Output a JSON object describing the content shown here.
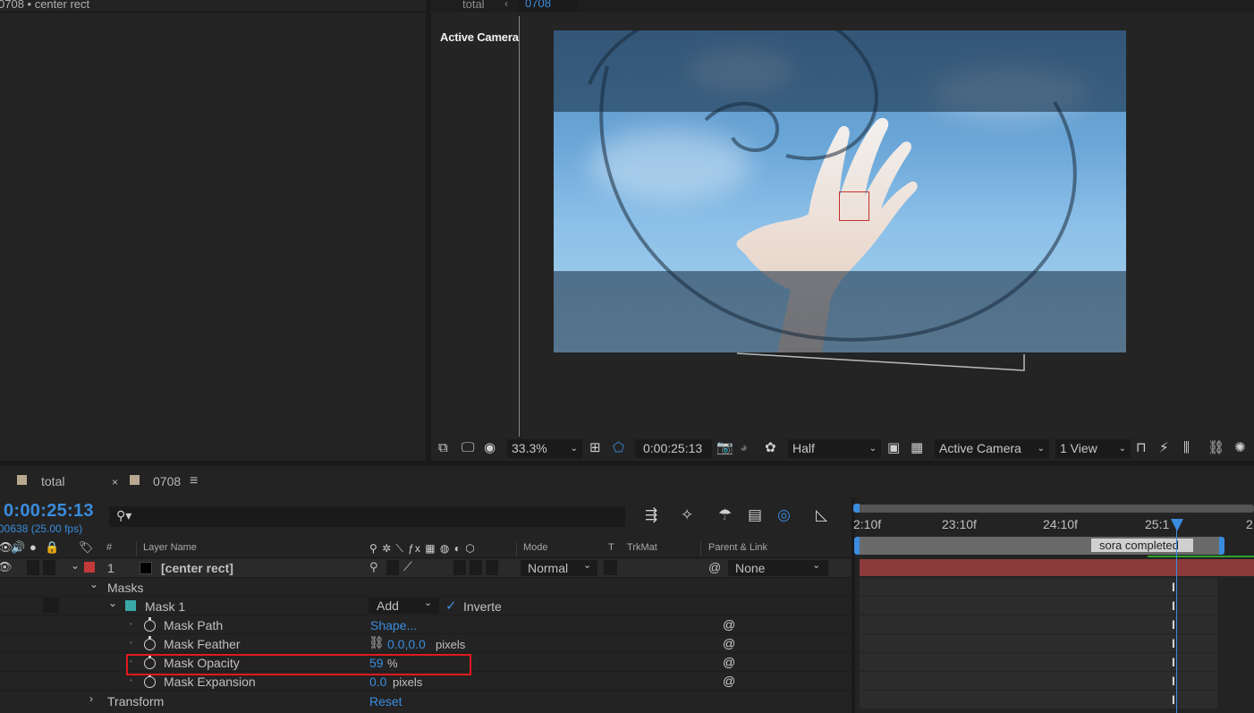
{
  "project_panel": {
    "title": "0708 • center rect"
  },
  "viewer": {
    "tab_total": "total",
    "tab_arrow": "‹",
    "tab_comp": "0708",
    "camera_label": "Active Camera",
    "toolbar": {
      "zoom": "33.3%",
      "timecode": "0:00:25:13",
      "resolution": "Half",
      "camera": "Active Camera",
      "views": "1 View"
    }
  },
  "timeline": {
    "tabs": [
      {
        "label": "total",
        "close": ""
      },
      {
        "label": "0708",
        "close": "×",
        "menu": "≡"
      }
    ],
    "current_time": "0:00:25:13",
    "frame_info": "00638 (25.00 fps)",
    "search_placeholder": "",
    "columns": {
      "number": "#",
      "layer_name": "Layer Name",
      "mode": "Mode",
      "t": "T",
      "trkmat": "TrkMat",
      "parent": "Parent & Link"
    },
    "ruler_labels": [
      "2:10f",
      "23:10f",
      "24:10f",
      "25:1",
      "2"
    ],
    "marker_label": "sora completed",
    "layer": {
      "number": "1",
      "name": "[center rect]",
      "mode": "Normal",
      "parent": "None"
    },
    "masks_group": "Masks",
    "mask": {
      "name": "Mask 1",
      "mode": "Add",
      "inverted_label": "Inverte",
      "inverted": true
    },
    "properties": [
      {
        "name": "Mask Path",
        "value": "Shape...",
        "unit": ""
      },
      {
        "name": "Mask Feather",
        "value": "0.0,0.0",
        "unit": "pixels"
      },
      {
        "name": "Mask Opacity",
        "value": "59",
        "unit": "%"
      },
      {
        "name": "Mask Expansion",
        "value": "0.0",
        "unit": "pixels"
      }
    ],
    "transform": {
      "name": "Transform",
      "value": "Reset"
    }
  },
  "colors": {
    "accent": "#3a8cdd",
    "highlight": "#e0191f",
    "layer_label": "#c23a3a",
    "mask_color": "#3aa8a8",
    "layer_bar": "#8a3a3a"
  }
}
